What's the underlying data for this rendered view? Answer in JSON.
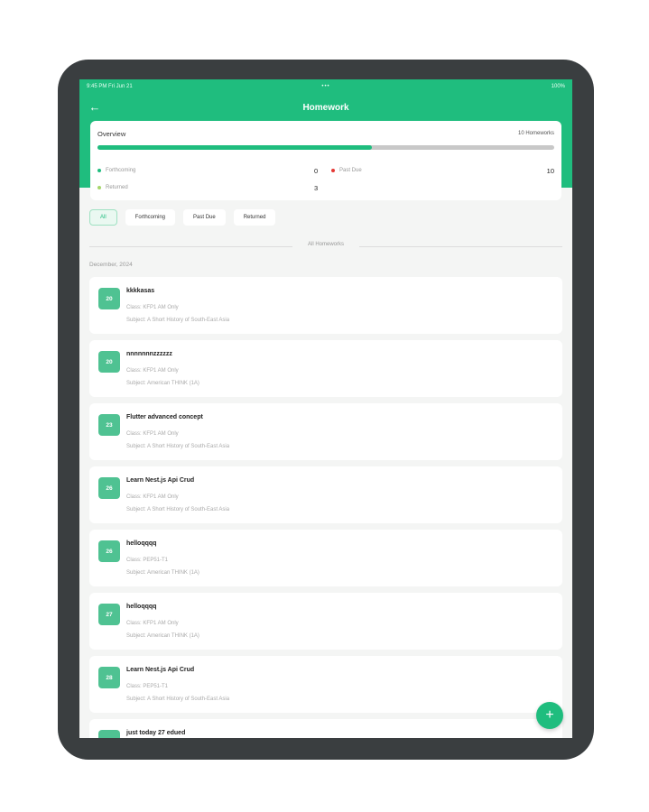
{
  "status": {
    "left": "9:45 PM  Fri Jun 21",
    "center": "•••",
    "right": "100%"
  },
  "appbar": {
    "title": "Homework"
  },
  "overview": {
    "title": "Overview",
    "count_label": "10 Homeworks",
    "progress": 0.6,
    "forthcoming_label": "Forthcoming",
    "forthcoming_value": "0",
    "past_due_label": "Past Due",
    "past_due_value": "10",
    "returned_label": "Returned",
    "returned_value": "3"
  },
  "filters": [
    "All",
    "Forthcoming",
    "Past Due",
    "Returned"
  ],
  "list_header": "All Homeworks",
  "month": "December, 2024",
  "homeworks": [
    {
      "day": "20",
      "title": "kkkkasas",
      "class": "Class: KFP1 AM Only",
      "subject": "Subject: A Short History of South-East Asia"
    },
    {
      "day": "20",
      "title": "nnnnnnnzzzzzz",
      "class": "Class: KFP1 AM Only",
      "subject": "Subject: American THINK (1A)"
    },
    {
      "day": "23",
      "title": "Flutter advanced concept",
      "class": "Class: KFP1 AM Only",
      "subject": "Subject: A Short History of South-East Asia"
    },
    {
      "day": "26",
      "title": "Learn Nest.js Api Crud",
      "class": "Class: KFP1 AM Only",
      "subject": "Subject: A Short History of South-East Asia"
    },
    {
      "day": "26",
      "title": "helloqqqq",
      "class": "Class: PEP51-T1",
      "subject": "Subject: American THINK (1A)"
    },
    {
      "day": "27",
      "title": "helloqqqq",
      "class": "Class: KFP1 AM Only",
      "subject": "Subject: American THINK (1A)"
    },
    {
      "day": "28",
      "title": "Learn Nest.js Api Crud",
      "class": "Class: PEP51-T1",
      "subject": "Subject: A Short History of South-East Asia"
    },
    {
      "day": "29",
      "title": "just today 27 edued",
      "class": "",
      "subject": ""
    }
  ],
  "colors": {
    "brand": "#1fbd7e",
    "badge": "#4fc292",
    "past_due": "#e53935",
    "forthcoming": "#1fbd7e",
    "returned": "#a6d66a"
  },
  "icons": {
    "back": "arrow-left-icon",
    "fab": "plus-icon"
  }
}
